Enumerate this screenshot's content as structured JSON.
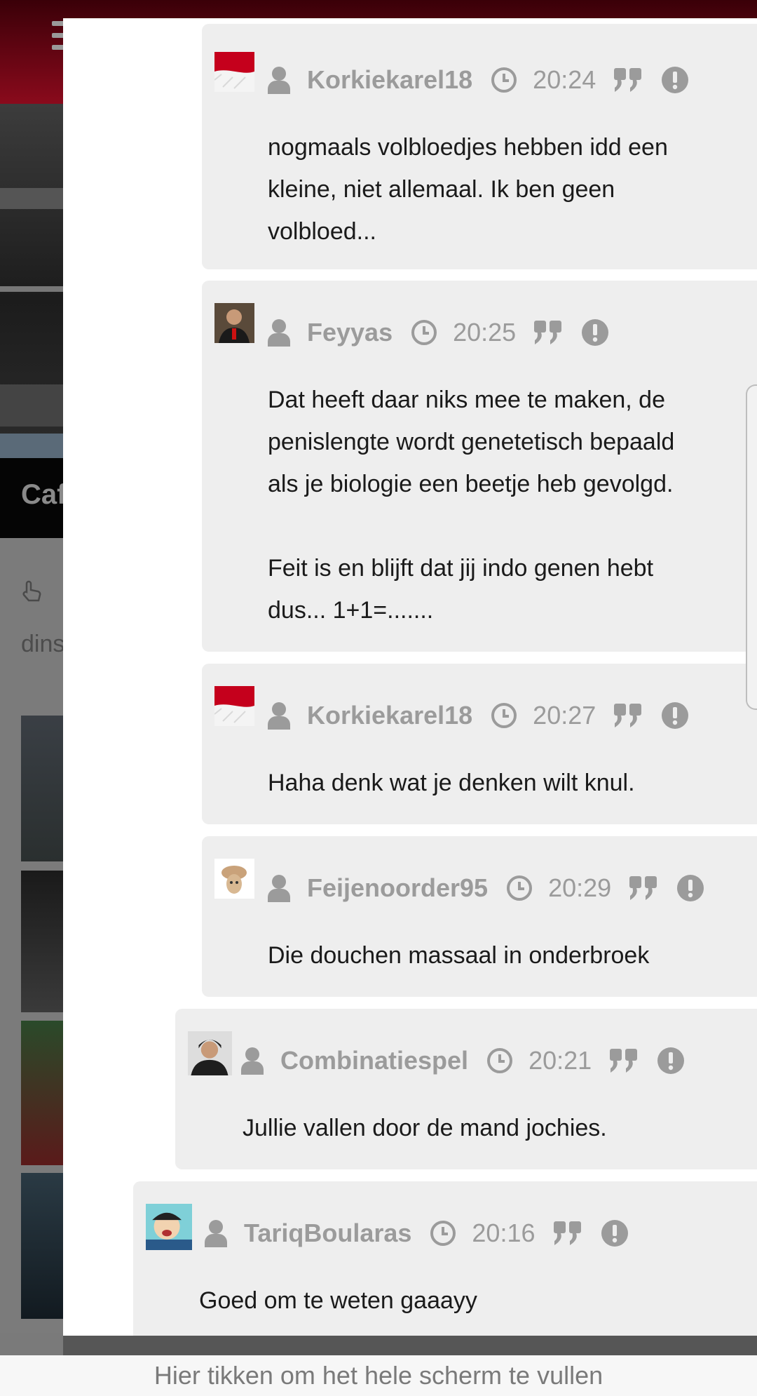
{
  "background_page": {
    "hero_title": "Caf",
    "date_prefix": "dins"
  },
  "comments": [
    {
      "username": "Korkiekarel18",
      "time": "20:24",
      "avatar": "flag-avatar",
      "text": "nogmaals volbloedjes hebben idd een\nkleine, niet allemaal. Ik ben geen\nvolbloed..."
    },
    {
      "username": "Feyyas",
      "time": "20:25",
      "avatar": "person-photo-avatar",
      "text": "Dat heeft daar niks mee te maken, de\npenislengte wordt genetetisch bepaald\nals je biologie een beetje heb gevolgd.\n\nFeit is en blijft dat jij indo genen hebt\ndus... 1+1=......."
    },
    {
      "username": "Korkiekarel18",
      "time": "20:27",
      "avatar": "flag-avatar",
      "text": "Haha denk wat je denken wilt knul."
    },
    {
      "username": "Feijenoorder95",
      "time": "20:29",
      "avatar": "plush-toy-avatar",
      "text": "Die douchen massaal in onderbroek"
    },
    {
      "username": "Combinatiespel",
      "time": "20:21",
      "avatar": "person-photo-avatar",
      "text": "Jullie vallen door de mand jochies."
    },
    {
      "username": "TariqBoularas",
      "time": "20:16",
      "avatar": "cartoon-avatar",
      "text": "Goed om te weten gaaayy"
    }
  ],
  "bottom_bar": {
    "label": "Hier tikken om het hele scherm te vullen"
  },
  "colors": {
    "bubble": "#eeeeee",
    "meta_gray": "#9b9b9b",
    "brand_red": "#8a0a1c"
  }
}
